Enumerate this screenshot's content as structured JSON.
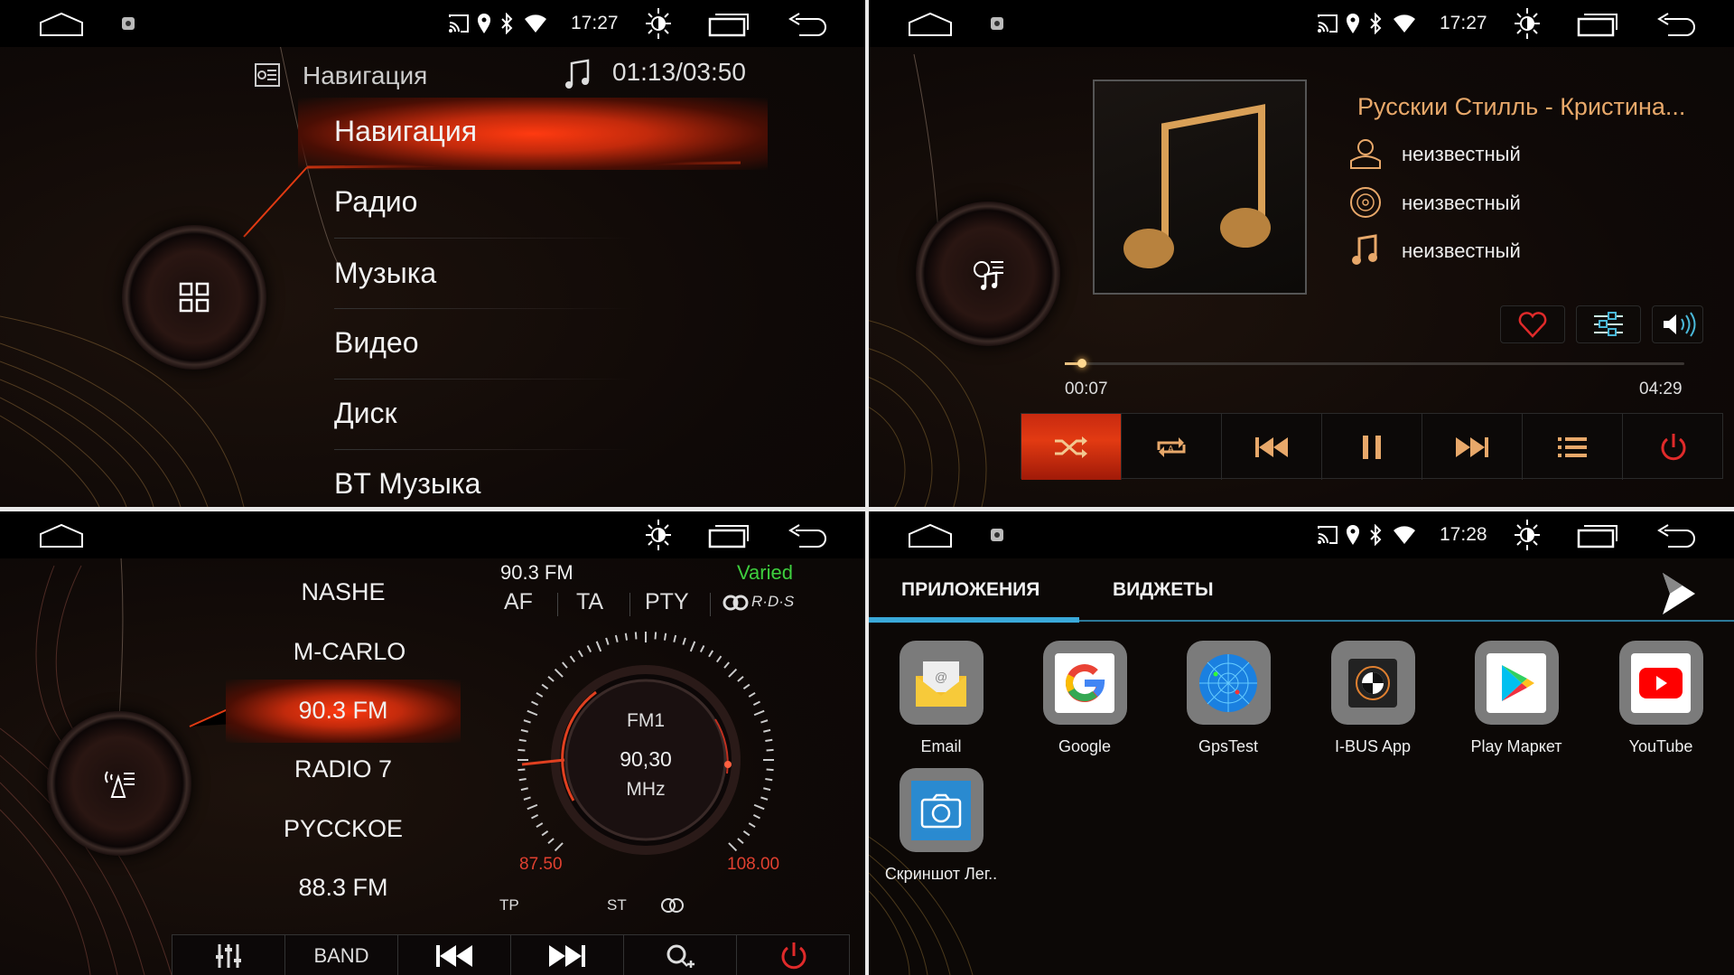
{
  "colors": {
    "accent_red": "#e23a12",
    "gold": "#e8a86a",
    "tab_blue": "#3aa9d9",
    "varied_green": "#3ecf3e",
    "range_red": "#e04030"
  },
  "status_icons": [
    "home-icon",
    "screenshot-icon",
    "cast-icon",
    "location-icon",
    "bluetooth-icon",
    "wifi-icon",
    "brightness-icon",
    "recent-apps-icon",
    "back-icon"
  ],
  "menu_panel": {
    "status": {
      "time": "17:27"
    },
    "header_source": "Навигация",
    "header_time": "01:13/03:50",
    "items": [
      "Навигация",
      "Радио",
      "Музыка",
      "Видео",
      "Диск",
      "BT Музыка"
    ],
    "selected": "Навигация"
  },
  "music_panel": {
    "status": {
      "time": "17:27"
    },
    "title": "Русскии Стилль -  Кристина...",
    "artist": "неизвестный",
    "album": "неизвестный",
    "genre": "неизвестный",
    "elapsed": "00:07",
    "duration": "04:29",
    "progress_fraction": 0.026,
    "controls": [
      "shuffle",
      "repeat-all",
      "previous",
      "pause",
      "next",
      "playlist",
      "power"
    ],
    "active_control": "shuffle"
  },
  "radio_panel": {
    "stations": [
      "NASHE",
      "M-CARLO",
      "90.3 FM",
      "RADIO 7",
      "PYCCKOE",
      "88.3 FM"
    ],
    "selected": "90.3 FM",
    "rds_station": "90.3 FM",
    "pty_value": "Varied",
    "flags": [
      "AF",
      "TA",
      "PTY"
    ],
    "rds_logo": "R·D·S",
    "band": "FM1",
    "frequency": "90,30",
    "unit": "MHz",
    "range_min": "87.50",
    "range_max": "108.00",
    "tp": "TP",
    "st": "ST",
    "buttons": {
      "band": "BAND"
    }
  },
  "apps_panel": {
    "status": {
      "time": "17:28"
    },
    "tabs": [
      "ПРИЛОЖЕНИЯ",
      "ВИДЖЕТЫ"
    ],
    "active_tab": "ПРИЛОЖЕНИЯ",
    "apps": [
      "Email",
      "Google",
      "GpsTest",
      "I-BUS App",
      "Play Маркет",
      "YouTube",
      "Скриншот Лег.."
    ]
  }
}
